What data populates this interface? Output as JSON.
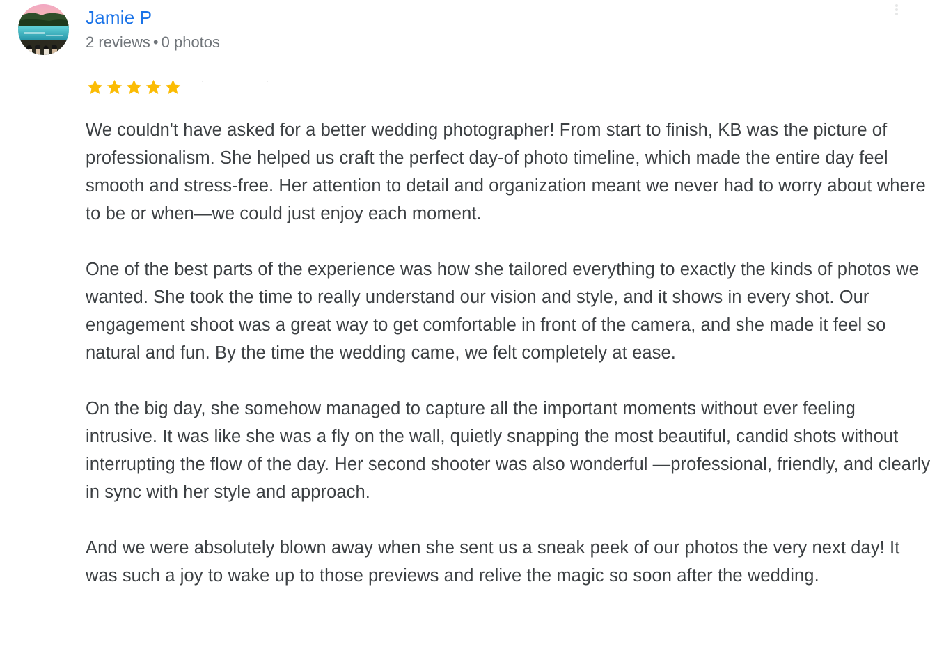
{
  "reviewer": {
    "name": "Jamie P",
    "reviews_count": "2 reviews",
    "separator": "•",
    "photos_count": "0 photos",
    "avatar_icon": "avatar-landscape-photo"
  },
  "rating": {
    "stars": 5,
    "max_stars": 5,
    "color": "#fbbc04"
  },
  "review": {
    "paragraphs": [
      "We couldn't have asked for a better wedding photographer! From start to finish, KB was the picture of professionalism. She helped us craft the perfect day-of photo timeline, which made the entire day feel smooth and stress-free. Her attention to detail and organization meant we never had to worry about where to be or when—we could just enjoy each moment.",
      "One of the best parts of the experience was how she tailored everything to exactly the kinds of photos we wanted. She took the time to really understand our vision and style, and it shows in every shot. Our engagement shoot was a great way to get comfortable in front of the camera, and she made it feel so natural and fun. By the time the wedding came, we felt completely at ease.",
      "On the big day, she somehow managed to capture all the important moments without ever feeling intrusive. It was like she was a fly on the wall, quietly snapping the most beautiful, candid shots without interrupting the flow of the day. Her second shooter was also wonderful —professional, friendly, and clearly in sync with her style and approach.",
      "And we were absolutely blown away when she sent us a sneak peek of our photos the very next day! It was such a joy to wake up to those previews and relive the magic so soon after the wedding."
    ]
  },
  "colors": {
    "name_link": "#1a73e8",
    "meta_text": "#70757a",
    "body_text": "#3c4043",
    "star": "#fbbc04"
  }
}
